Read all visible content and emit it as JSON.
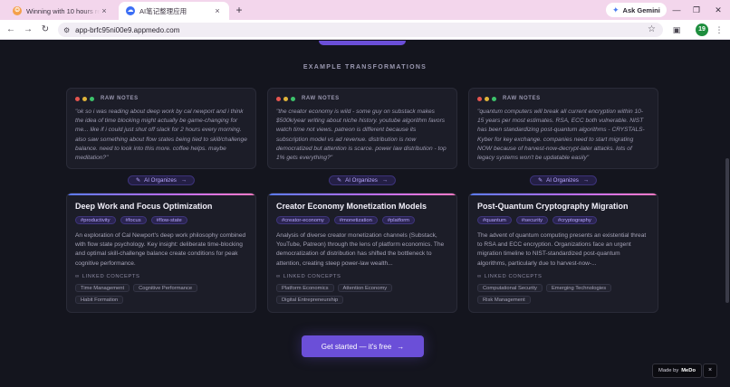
{
  "browser": {
    "tabs": [
      {
        "title": "Winning with 10 hours remaining",
        "close_icon": "×"
      },
      {
        "title": "AI笔记整理应用",
        "close_icon": "×"
      }
    ],
    "new_tab_icon": "+",
    "ask_gemini_label": "Ask Gemini",
    "url": "app-brfc95ni00e9.appmedo.com",
    "profile_initials": "19"
  },
  "page": {
    "section_heading": "EXAMPLE TRANSFORMATIONS",
    "raw_label": "RAW NOTES",
    "organize_label": "AI Organizes",
    "linked_label": "LINKED CONCEPTS",
    "columns": [
      {
        "raw_text": "\"ok so i was reading about deep work by cal newport and i think the idea of time blocking might actually be game-changing for me... like if i could just shut off slack for 2 hours every morning. also saw something about flow states being tied to skill/challenge balance. need to look into this more. coffee helps. maybe meditation?\"",
        "title": "Deep Work and Focus Optimization",
        "tags": [
          "#productivity",
          "#focus",
          "#flow-state"
        ],
        "summary": "An exploration of Cal Newport's deep work philosophy combined with flow state psychology. Key insight: deliberate time-blocking and optimal skill-challenge balance create conditions for peak cognitive performance.",
        "concepts": [
          "Time Management",
          "Cognitive Performance",
          "Habit Formation"
        ]
      },
      {
        "raw_text": "\"the creator economy is wild - some guy on substack makes $500k/year writing about niche history. youtube algorithm favors watch time not views. patreon is different because its subscription model vs ad revenue. distribution is now democratized but attention is scarce. power law distribution - top 1% gets everything?\"",
        "title": "Creator Economy Monetization Models",
        "tags": [
          "#creator-economy",
          "#monetization",
          "#platform"
        ],
        "summary": "Analysis of diverse creator monetization channels (Substack, YouTube, Patreon) through the lens of platform economics. The democratization of distribution has shifted the bottleneck to attention, creating steep power-law wealth...",
        "concepts": [
          "Platform Economics",
          "Attention Economy",
          "Digital Entrepreneurship"
        ]
      },
      {
        "raw_text": "\"quantum computers will break all current encryption within 10-15 years per most estimates. RSA, ECC both vulnerable. NIST has been standardizing post-quantum algorithms - CRYSTALS-Kyber for key exchange. companies need to start migrating NOW because of harvest-now-decrypt-later attacks. lots of legacy systems won't be updatable easily\"",
        "title": "Post-Quantum Cryptography Migration",
        "tags": [
          "#quantum",
          "#security",
          "#cryptography"
        ],
        "summary": "The advent of quantum computing presents an existential threat to RSA and ECC encryption. Organizations face an urgent migration timeline to NIST-standardized post-quantum algorithms, particularly due to harvest-now-...",
        "concepts": [
          "Computational Security",
          "Emerging Technologies",
          "Risk Management"
        ]
      }
    ],
    "cta_label": "Get started — it's free",
    "made_by_label": "Made by",
    "made_by_brand": "MeDo",
    "made_by_close": "×"
  },
  "colors": {
    "background": "#14151e",
    "card": "#1c1d28",
    "accent": "#6b4fd8",
    "tag_text": "#b9a8ff",
    "dot_red": "#e5554f",
    "dot_yellow": "#e0b43a",
    "dot_green": "#3cc26b"
  }
}
